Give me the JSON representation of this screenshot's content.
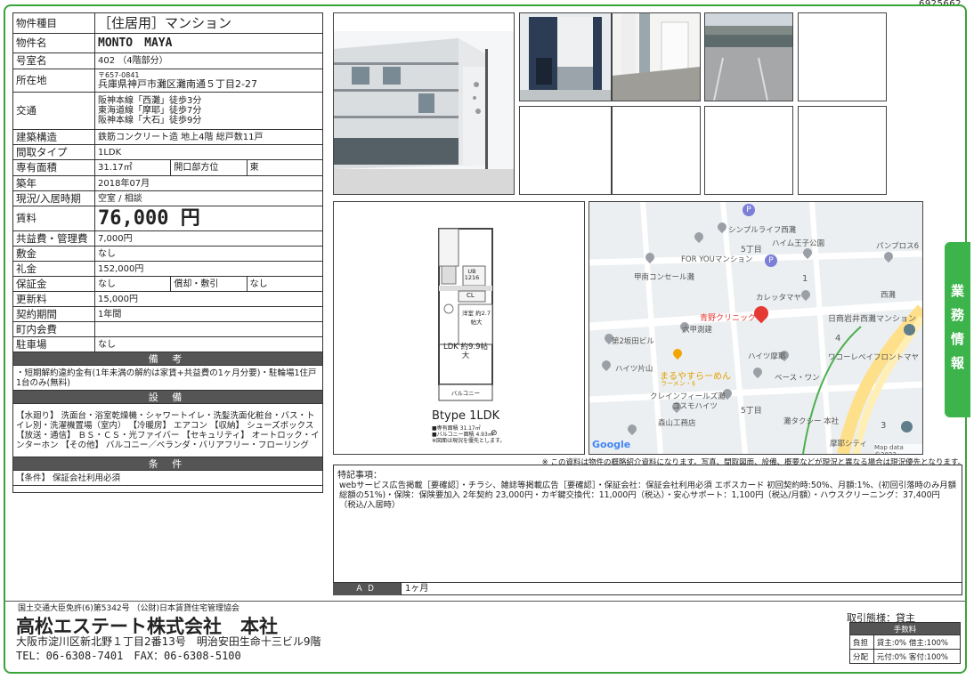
{
  "doc_id": "6925662",
  "info": {
    "type_label": "物件種目",
    "type_value": "［住居用］マンション",
    "name_label": "物件名",
    "name_value": "MONTO　MAYA",
    "room_label": "号室名",
    "room_value": "402 （4階部分）",
    "addr_label": "所在地",
    "zip": "〒657-0841",
    "addr_value": "兵庫県神戸市灘区灘南通５丁目2-27",
    "traffic_label": "交通",
    "traffic": [
      "阪神本線「西灘」徒歩3分",
      "東海道線「摩耶」徒歩7分",
      "阪神本線「大石」徒歩9分"
    ],
    "structure_label": "建築構造",
    "structure_value": "鉄筋コンクリート造 地上4階 総戸数11戸",
    "layout_label": "間取タイプ",
    "layout_value": "1LDK",
    "area_label": "専有面積",
    "area_value": "31.17㎡",
    "dir_label": "開口部方位",
    "dir_value": "東",
    "built_label": "築年",
    "built_value": "2018年07月",
    "status_label": "現況/入居時期",
    "status_value": "空室 / 相談",
    "rent_label": "賃料",
    "rent_value": "76,000 円",
    "common_label": "共益費・管理費",
    "common_value": "7,000円",
    "deposit_label": "敷金",
    "deposit_value": "なし",
    "key_label": "礼金",
    "key_value": "152,000円",
    "guarantee_label": "保証金",
    "guarantee_value": "なし",
    "amort_label": "償却・敷引",
    "amort_value": "なし",
    "renew_label": "更新料",
    "renew_value": "15,000円",
    "contract_label": "契約期間",
    "contract_value": "1年間",
    "assoc_label": "町内会費",
    "assoc_value": "",
    "parking_label": "駐車場",
    "parking_value": "なし",
    "remarks_header": "備 考",
    "remarks_text": "・短期解約違約金有(1年未満の解約は家賃+共益費の1ヶ月分要)・駐輪場1住戸1台のみ(無料)",
    "facilities_header": "設 備",
    "facilities_text": "【水廻り】 洗面台・浴室乾燥機・シャワートイレ・洗髪洗面化粧台・バス・トイレ別・洗濯機置場（室内） 【冷暖房】 エアコン 【収納】 シューズボックス 【放送・通信】 ＢＳ・ＣＳ・光ファイバー 【セキュリティ】 オートロック・インターホン 【その他】 バルコニー／ベランダ・バリアフリー・フローリング",
    "conditions_header": "条 件",
    "conditions_text": "【条件】 保証会社利用必須"
  },
  "floorplan": {
    "type_label": "Btype 1LDK",
    "area_line": "■専有面積 31.17㎡",
    "balcony_line": "■バルコニー面積 4.93㎡",
    "note_line": "※図面は現況を優先とします。",
    "ldk": "LDK 約9.9帖 大",
    "bedroom": "洋室 約2.7帖大",
    "balcony": "バルコニー",
    "ub": "UB 1216",
    "cl": "CL"
  },
  "map": {
    "labels": [
      "シンプルライフ西灘",
      "5丁目",
      "ハイム王子公園",
      "パンプロス6",
      "FOR YOUマンション",
      "甲南コンセール灘",
      "カレッタマヤ",
      "西灘",
      "日商岩井西灘マンション",
      "青野クリニック",
      "六甲測建",
      "第2坂田ビル",
      "まるやすらーめん",
      "ラーメン・$",
      "ハイツ片山",
      "ハイツ摩耶",
      "ワコーレベイフロントマヤ",
      "ベース・ワン",
      "クレインフィールズ灘",
      "コスモハイツ",
      "5丁目",
      "森山工務店",
      "灘タクシー 本社",
      "摩耶シティ",
      "4",
      "1",
      "3"
    ],
    "logo": "Google",
    "copyright": "Map data ©2023"
  },
  "disclaimer": "※ この資料は物件の概略紹介資料になります。写真、間取図面、設備、概要などが現況と異なる場合は現況優先となります。",
  "notes": {
    "title": "特記事項：",
    "text": "webサービス広告掲載［要確認］・チラシ、雑誌等掲載広告［要確認］・保証会社：保証会社利用必須 エポスカード 初回契約時:50%、月額:1%、(初回引落時のみ月額総額の51%)・保険：保険要加入 2年契約 23,000円・カギ鍵交換代：11,000円（税込）・安心サポート：1,100円（税込/月額）・ハウスクリーニング：37,400円（税込/入居時）",
    "ad_label": "ＡＤ",
    "ad_value": "1ヶ月"
  },
  "side_tab": "業務情報",
  "footer": {
    "license": "国土交通大臣免許(6)第5342号 （公財)日本賃貸住宅管理協会",
    "company": "高松エステート株式会社　本社",
    "address": "大阪市淀川区新北野１丁目2番13号　明治安田生命十三ビル9階",
    "tel": "TEL：06-6308-7401　FAX：06-6308-5100",
    "trade": "取引態様：貸主",
    "fee_header": "手数料",
    "fee_rows": [
      {
        "label": "負担",
        "value": "貸主:0% 借主:100%"
      },
      {
        "label": "分配",
        "value": "元付:0% 客付:100%"
      }
    ]
  },
  "colors": {
    "accent_green": "#3cb44b",
    "section_gray": "#555555",
    "map_pin_red": "#e53935"
  }
}
